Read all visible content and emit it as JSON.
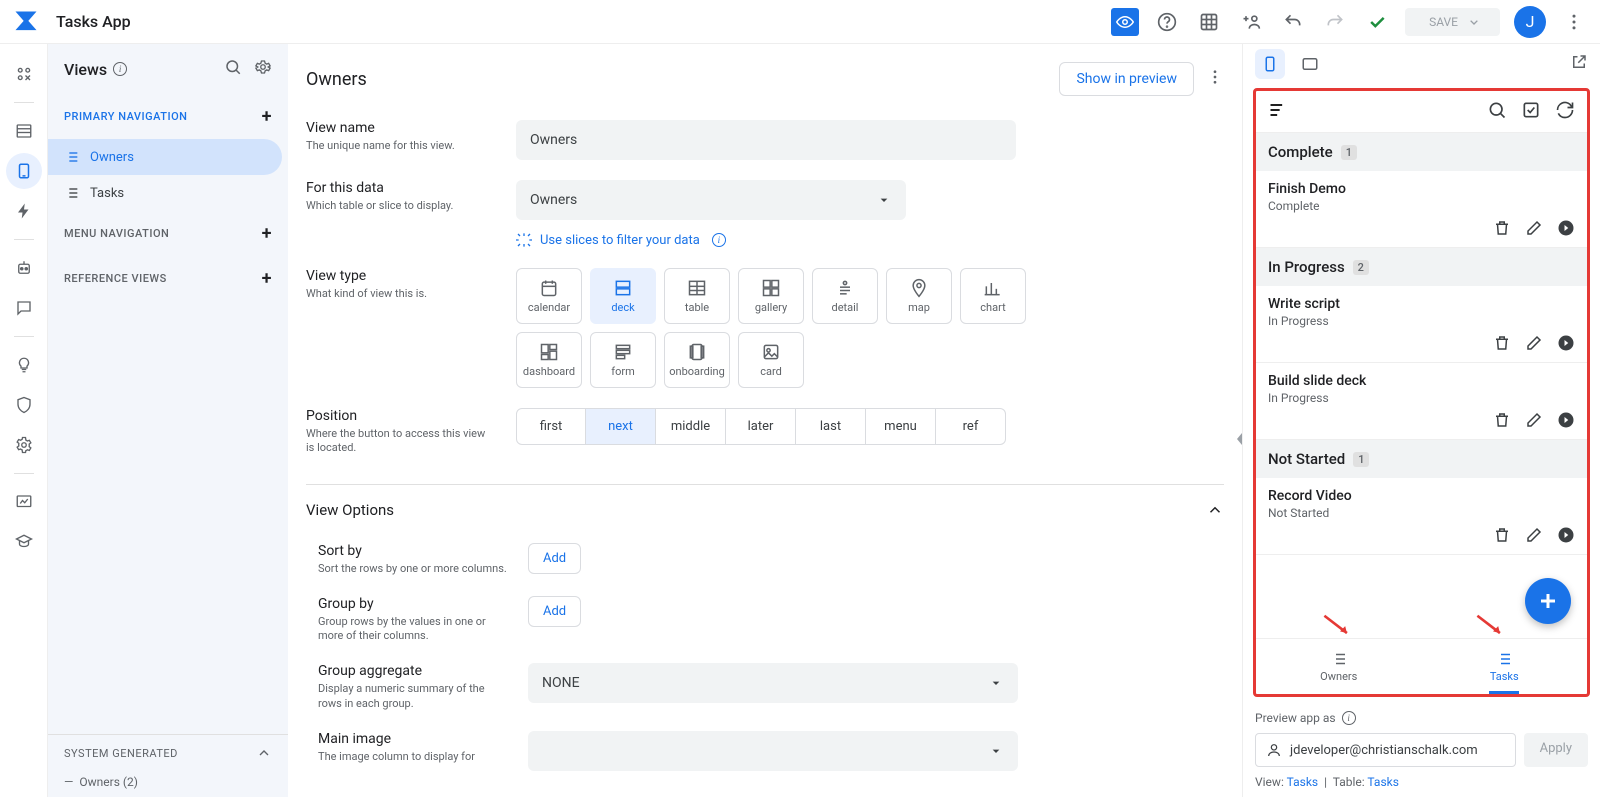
{
  "header": {
    "app_title": "Tasks App",
    "save_label": "SAVE",
    "avatar_initial": "J"
  },
  "views_panel": {
    "title": "Views",
    "sections": {
      "primary": "PRIMARY NAVIGATION",
      "menu": "MENU NAVIGATION",
      "reference": "REFERENCE VIEWS",
      "system": "SYSTEM GENERATED",
      "system_sub": "Owners (2)"
    },
    "items": [
      "Owners",
      "Tasks"
    ]
  },
  "editor": {
    "title": "Owners",
    "show_in_preview": "Show in preview",
    "view_name": {
      "label": "View name",
      "desc": "The unique name for this view.",
      "value": "Owners"
    },
    "for_data": {
      "label": "For this data",
      "desc": "Which table or slice to display.",
      "value": "Owners",
      "hint": "Use slices to filter your data"
    },
    "view_type": {
      "label": "View type",
      "desc": "What kind of view this is.",
      "options": [
        "calendar",
        "deck",
        "table",
        "gallery",
        "detail",
        "map",
        "chart",
        "dashboard",
        "form",
        "onboarding",
        "card"
      ],
      "selected": "deck"
    },
    "position": {
      "label": "Position",
      "desc": "Where the button to access this view is located.",
      "options": [
        "first",
        "next",
        "middle",
        "later",
        "last",
        "menu",
        "ref"
      ],
      "selected": "next"
    },
    "options_header": "View Options",
    "sort_by": {
      "label": "Sort by",
      "desc": "Sort the rows by one or more columns.",
      "btn": "Add"
    },
    "group_by": {
      "label": "Group by",
      "desc": "Group rows by the values in one or more of their columns.",
      "btn": "Add"
    },
    "group_agg": {
      "label": "Group aggregate",
      "desc": "Display a numeric summary of the rows in each group.",
      "value": "NONE"
    },
    "main_image": {
      "label": "Main image",
      "desc": "The image column to display for"
    }
  },
  "preview": {
    "groups": [
      {
        "name": "Complete",
        "count": "1",
        "items": [
          {
            "title": "Finish Demo",
            "status": "Complete"
          }
        ]
      },
      {
        "name": "In Progress",
        "count": "2",
        "items": [
          {
            "title": "Write script",
            "status": "In Progress"
          },
          {
            "title": "Build slide deck",
            "status": "In Progress"
          }
        ]
      },
      {
        "name": "Not Started",
        "count": "1",
        "items": [
          {
            "title": "Record Video",
            "status": "Not Started"
          }
        ]
      }
    ],
    "bottom_nav": [
      "Owners",
      "Tasks"
    ],
    "footer": {
      "preview_as": "Preview app as",
      "email": "jdeveloper@christianschalk.com",
      "apply": "Apply",
      "view_label": "View:",
      "view_value": "Tasks",
      "table_label": "Table:",
      "table_value": "Tasks"
    }
  }
}
